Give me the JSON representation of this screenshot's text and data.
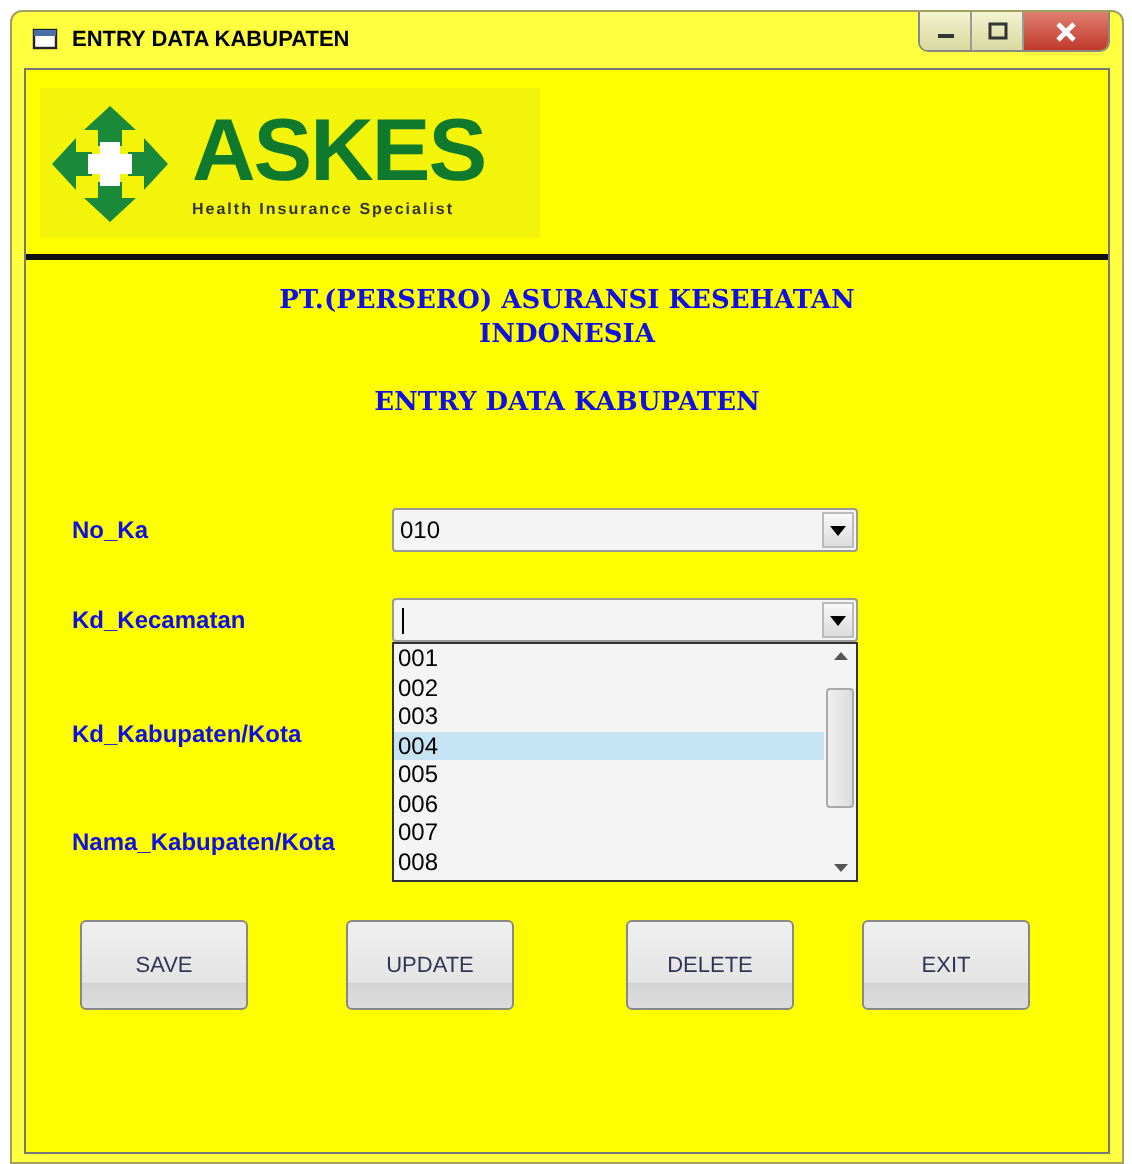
{
  "window": {
    "title": "ENTRY DATA KABUPATEN"
  },
  "logo": {
    "name": "ASKES",
    "tagline": "Health Insurance Specialist"
  },
  "heading": {
    "company": "PT.(PERSERO) ASURANSI KESEHATAN INDONESIA",
    "title": "ENTRY DATA KABUPATEN"
  },
  "fields": [
    {
      "label": "No_Ka",
      "kind": "combo",
      "value": "010"
    },
    {
      "label": "Kd_Kecamatan",
      "kind": "combo"
    },
    {
      "label": "Kd_Kabupaten/Kota",
      "kind": "label"
    },
    {
      "label": "Nama_Kabupaten/Kota",
      "kind": "label"
    }
  ],
  "dropdown": {
    "items": [
      {
        "label": "001",
        "selected": false
      },
      {
        "label": "002",
        "selected": false
      },
      {
        "label": "003",
        "selected": false
      },
      {
        "label": "004",
        "selected": true
      },
      {
        "label": "005",
        "selected": false
      },
      {
        "label": "006",
        "selected": false
      },
      {
        "label": "007",
        "selected": false
      },
      {
        "label": "008",
        "selected": false
      }
    ]
  },
  "buttons": [
    "SAVE",
    "UPDATE",
    "DELETE",
    "EXIT"
  ]
}
